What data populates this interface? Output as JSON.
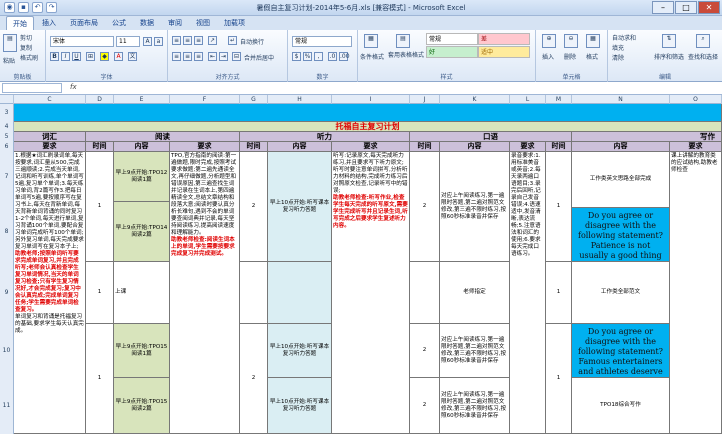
{
  "window": {
    "title": "暑假自主复习计划-2014年5-6月.xls [兼容模式] - Microsoft Excel"
  },
  "tabs": [
    "开始",
    "插入",
    "页面布局",
    "公式",
    "数据",
    "审阅",
    "视图",
    "加载项"
  ],
  "ribbon": {
    "clipboard": {
      "cut": "剪切",
      "copy": "复制",
      "format_painter": "格式刷",
      "paste": "粘贴",
      "group": "剪贴板"
    },
    "font": {
      "name": "宋体",
      "size": "11",
      "group": "字体"
    },
    "align": {
      "wrap": "自动换行",
      "merge": "合并后居中",
      "group": "对齐方式"
    },
    "number": {
      "format": "常规",
      "group": "数字"
    },
    "styles": {
      "conditional": "条件格式",
      "table": "套用表格格式",
      "normal": "常规",
      "bad": "差",
      "good": "好",
      "neutral": "适中",
      "group": "样式"
    },
    "cells": {
      "insert": "插入",
      "delete": "删除",
      "format": "格式",
      "group": "单元格"
    },
    "editing": {
      "autosum": "自动求和",
      "fill": "填充",
      "clear": "清除",
      "sort": "排序和筛选",
      "find": "查找和选择",
      "group": "编辑"
    }
  },
  "columns": [
    "C",
    "D",
    "E",
    "F",
    "G",
    "H",
    "I",
    "J",
    "K",
    "L",
    "M",
    "N",
    "O"
  ],
  "sheet": {
    "main_title": "托福自主复习计划",
    "sections": {
      "vocab": "词汇",
      "reading": "阅读",
      "listening": "听力",
      "speaking": "口语",
      "writing": "写作"
    },
    "headers": {
      "req": "要求",
      "time": "时间",
      "content": "内容"
    },
    "vocab_req": "1.根据★词汇刷录词单,每天按要求,词汇量从500,完成三遍顺读;2.完成当天单词,记词和听写训练,单个单词写5遍,复习单个单词;3.每天练习单词,背2篇写作3.把每日单词写5遍,要按顺序写在复习书上,每天在背新单词,每天背新单词背诵的同时复习1-2个单词,每天进行单词,复习背诵100个单词,要配合复习单词完成听写100个单词;另外复习单词,每天完成要求复习单词写在复习本子上;",
    "vocab_red": "助教老师;按照单词听写要求完成单词复习,并且完成听写;老师会认真检查学生复习单词情况,当天的单词复习检查;只有学生复习情况好,才会完成复习;复习中会认真完成;完成单词复习任务;学生需要完成单词检查复习。",
    "vocab_tail": "单词复习和背诵是托福复习的基础,要求学生每天认真完成。",
    "read_time_1": "1",
    "read_time_2": "1",
    "read_time_3": "1",
    "read_content_1": "早上9点开始:TPO12阅读1篇",
    "read_content_2": "早上9点开始:TPO14阅读2篇",
    "read_content_3": "早上9点开始:TPO15阅读1篇",
    "read_content_4": "早上9点开始:TPO15阅读2篇",
    "read_req": "TPO,官方指南的阅读:第一遍做题,限时完成,按照考试要求做题;第二遍先通读全文,再仔细做题,分析题型和错误原因,第三遍查找生词并记录在生词本上,第四遍精读全文,总结文章结构和段落大意;阅读时要认真分析长难句,遇到不会的单词要查阅词典并记录,每天坚持阅读练习,提高阅读速度和理解能力。",
    "read_red": "助教老师检查:阅读生词本上的单词,学生需要按要求完成复习并完成测试。",
    "read_label_mid": "上课",
    "listen_time_1": "2",
    "listen_time_2": "2",
    "listen_time_3": "2",
    "listen_content_1": "早上10点开始:听写课本复习听力答题",
    "listen_content_2": "早上10点开始:听写课本复习听力答题",
    "listen_content_3": "早上10点开始:听写课本复习听力答题",
    "listen_req": "听写:记录原文,每天完成听力练习,并且要求写下听力原文;听写时要注意单词拼写,分析听力材料的结构,完成听力练习后对照原文检查,记录听写中的错误;",
    "listen_red": "助教老师检查:听写作业,检查学生每天完成的听写原文,需要学生完成听写并且记录生词,听写完成之后要求学生复述听力内容。",
    "speak_time_1": "2",
    "speak_time_2": "2",
    "speak_time_3": "2",
    "speak_req_1": "对应上午阅读练习,第一遍限时答题,第二遍对照范文修改,第三遍不限时练习,按照60秒标准录音并保存",
    "speak_req_2": "对应上午阅读练习,第一遍限时答题,第二遍对照范文修改,第三遍不限时练习,按照60秒标准录音并保存",
    "speak_req_3": "对应上午阅读练习,第一遍限时答题,第二遍对照范文修改,第三遍不限时练习,按照60秒标准录音并保存",
    "speak_mid": "老师指定",
    "speak_col_l": "录音要求:1.用标准美音或英音;2.每天录两遍口语题目;3.录完后回听,记录自己发音错误;4.语速适中,发音清晰,表达流畅;5.注意语法和词汇的使用;6.要求每天完成口语练习。",
    "write_time_1": "1",
    "write_time_2": "1",
    "write_time_3": "1",
    "write_content_1": "工作类英文思路全部完成",
    "write_q1": "Do you agree or disagree with the following statement? Patience is not usually a good thing and we need to take actions at once.",
    "write_content_2": "工作类全部范文",
    "write_q2": "Do you agree or disagree with the following statement? Famous entertainers and athletes deserve to have more privacy than they have now.",
    "write_content_3": "TPO18综合写作",
    "write_req_right": "课上讲解的教育类的应试结构,助教老师检查",
    "row_numbers": [
      "3",
      "4",
      "5",
      "6",
      "7",
      "8",
      "9",
      "10",
      "11"
    ]
  }
}
